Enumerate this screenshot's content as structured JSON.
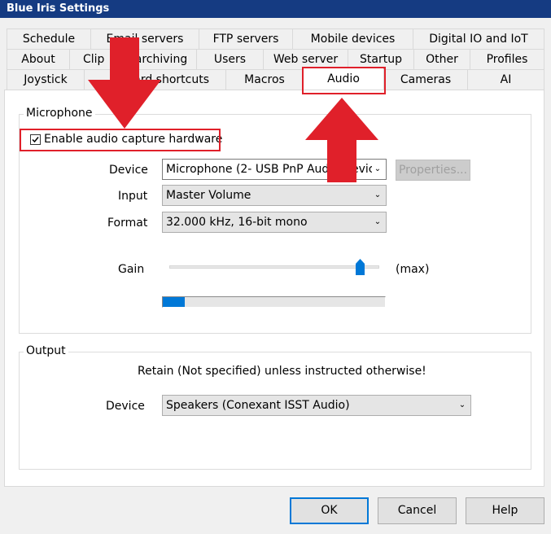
{
  "window": {
    "title": "Blue Iris Settings"
  },
  "tabs": {
    "row1": [
      "Schedule",
      "Email servers",
      "FTP servers",
      "Mobile devices",
      "Digital IO and IoT"
    ],
    "row2": [
      "About",
      "Clip",
      "archiving",
      "Users",
      "Web server",
      "Startup",
      "Other",
      "Profiles"
    ],
    "row3": [
      "Joystick",
      "oard shortcuts",
      "Macros",
      "Audio",
      "Cameras",
      "AI"
    ]
  },
  "microphone": {
    "group_title": "Microphone",
    "enable_label": "Enable audio capture hardware",
    "enable_checked": true,
    "device_label": "Device",
    "device_value": "Microphone (2- USB PnP Audio Devic",
    "properties_label": "Properties...",
    "input_label": "Input",
    "input_value": "Master Volume",
    "format_label": "Format",
    "format_value": "32.000 kHz, 16-bit mono",
    "gain_label": "Gain",
    "gain_max_label": "(max)",
    "gain_level": 0.91,
    "level_meter": 0.1
  },
  "output": {
    "group_title": "Output",
    "retain_text": "Retain (Not specified) unless instructed otherwise!",
    "device_label": "Device",
    "device_value": "Speakers (Conexant ISST Audio)"
  },
  "buttons": {
    "ok": "OK",
    "cancel": "Cancel",
    "help": "Help"
  },
  "colors": {
    "annotation_red": "#e0202a",
    "accent": "#0078d7",
    "titlebar": "#153b82"
  }
}
